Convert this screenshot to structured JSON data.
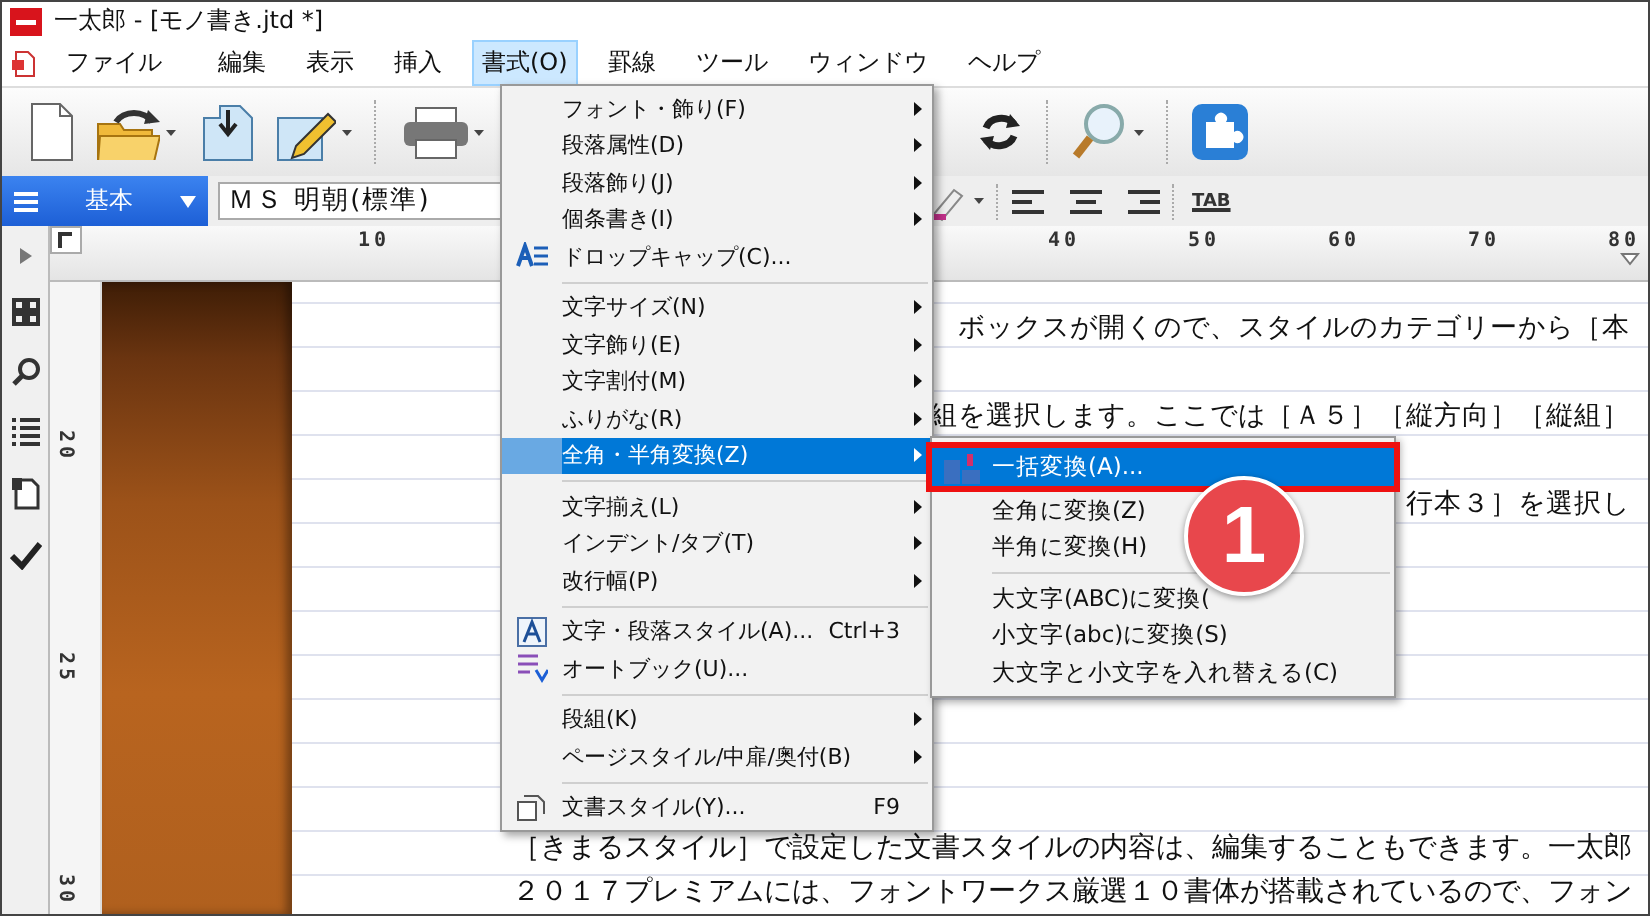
{
  "window": {
    "title": "一太郎 - [モノ書き.jtd *]"
  },
  "menu_bar": [
    {
      "label": "ファイル",
      "selected": false
    },
    {
      "label": "編集",
      "selected": false
    },
    {
      "label": "表示",
      "selected": false
    },
    {
      "label": "挿入",
      "selected": false
    },
    {
      "label": "書式(O)",
      "selected": true
    },
    {
      "label": "罫線",
      "selected": false
    },
    {
      "label": "ツール",
      "selected": false
    },
    {
      "label": "ウィンドウ",
      "selected": false
    },
    {
      "label": "ヘルプ",
      "selected": false
    }
  ],
  "format_bar": {
    "style": "基本",
    "font": "ＭＳ 明朝(標準)",
    "tab": "TAB"
  },
  "ruler": {
    "horizontal": [
      "10",
      "40",
      "50",
      "60",
      "70",
      "80"
    ],
    "vertical": [
      "20",
      "25",
      "30"
    ]
  },
  "document": {
    "lines_top": [
      "ボックスが開くので、スタイルのカテゴリーから［本",
      "組を選択します。ここでは［Ａ５］［縦方向］［縦組］",
      "行本３］を選択し"
    ],
    "lines_bottom": [
      "［きまるスタイル］で設定した文書スタイルの内容は、編集することもできます。一太郎",
      "２０１７プレミアムには、フォントワークス厳選１０書体が搭載されているので、フォン"
    ]
  },
  "format_menu": {
    "groups": [
      [
        {
          "label": "フォント・飾り(F)",
          "kind": "plain",
          "submenu": true,
          "selected": false
        },
        {
          "label": "段落属性(D)",
          "kind": "plain",
          "submenu": true,
          "selected": false
        },
        {
          "label": "段落飾り(J)",
          "kind": "plain",
          "submenu": true,
          "selected": false
        },
        {
          "label": "個条書き(I)",
          "kind": "plain",
          "submenu": true,
          "selected": false
        },
        {
          "label": "ドロップキャップ(C)...",
          "kind": "dropcap",
          "submenu": false,
          "selected": false
        }
      ],
      [
        {
          "label": "文字サイズ(N)",
          "kind": "plain",
          "submenu": true,
          "selected": false
        },
        {
          "label": "文字飾り(E)",
          "kind": "plain",
          "submenu": true,
          "selected": false
        },
        {
          "label": "文字割付(M)",
          "kind": "plain",
          "submenu": true,
          "selected": false
        },
        {
          "label": "ふりがな(R)",
          "kind": "plain",
          "submenu": true,
          "selected": false
        },
        {
          "label": "全角・半角変換(Z)",
          "kind": "plain",
          "submenu": true,
          "selected": true
        }
      ],
      [
        {
          "label": "文字揃え(L)",
          "kind": "plain",
          "submenu": true,
          "selected": false
        },
        {
          "label": "インデント/タブ(T)",
          "kind": "plain",
          "submenu": true,
          "selected": false
        },
        {
          "label": "改行幅(P)",
          "kind": "plain",
          "submenu": true,
          "selected": false
        }
      ],
      [
        {
          "label": "文字・段落スタイル(A)...",
          "kind": "style",
          "submenu": false,
          "selected": false,
          "shortcut": "Ctrl+3"
        },
        {
          "label": "オートブック(U)...",
          "kind": "autobook",
          "submenu": false,
          "selected": false
        }
      ],
      [
        {
          "label": "段組(K)",
          "kind": "plain",
          "submenu": true,
          "selected": false
        },
        {
          "label": "ページスタイル/中扉/奥付(B)",
          "kind": "plain",
          "submenu": true,
          "selected": false
        }
      ],
      [
        {
          "label": "文書スタイル(Y)...",
          "kind": "document",
          "submenu": false,
          "selected": false,
          "shortcut": "F9"
        }
      ]
    ]
  },
  "submenu": {
    "groups": [
      [
        {
          "label": "一括変換(A)...",
          "kind": "convert",
          "submenu": false,
          "selected": true,
          "marked": true
        },
        {
          "label": "全角に変換(Z)",
          "kind": "plain",
          "submenu": false,
          "selected": false,
          "marked": false
        },
        {
          "label": "半角に変換(H)",
          "kind": "plain",
          "submenu": false,
          "selected": false,
          "marked": false
        }
      ],
      [
        {
          "label": "大文字(ABC)に変換(",
          "kind": "plain",
          "submenu": false,
          "selected": false,
          "marked": false
        },
        {
          "label": "小文字(abc)に変換(S)",
          "kind": "plain",
          "submenu": false,
          "selected": false,
          "marked": false
        },
        {
          "label": "大文字と小文字を入れ替える(C)",
          "kind": "plain",
          "submenu": false,
          "selected": false,
          "marked": false
        }
      ]
    ]
  },
  "callout": {
    "number": "1"
  }
}
